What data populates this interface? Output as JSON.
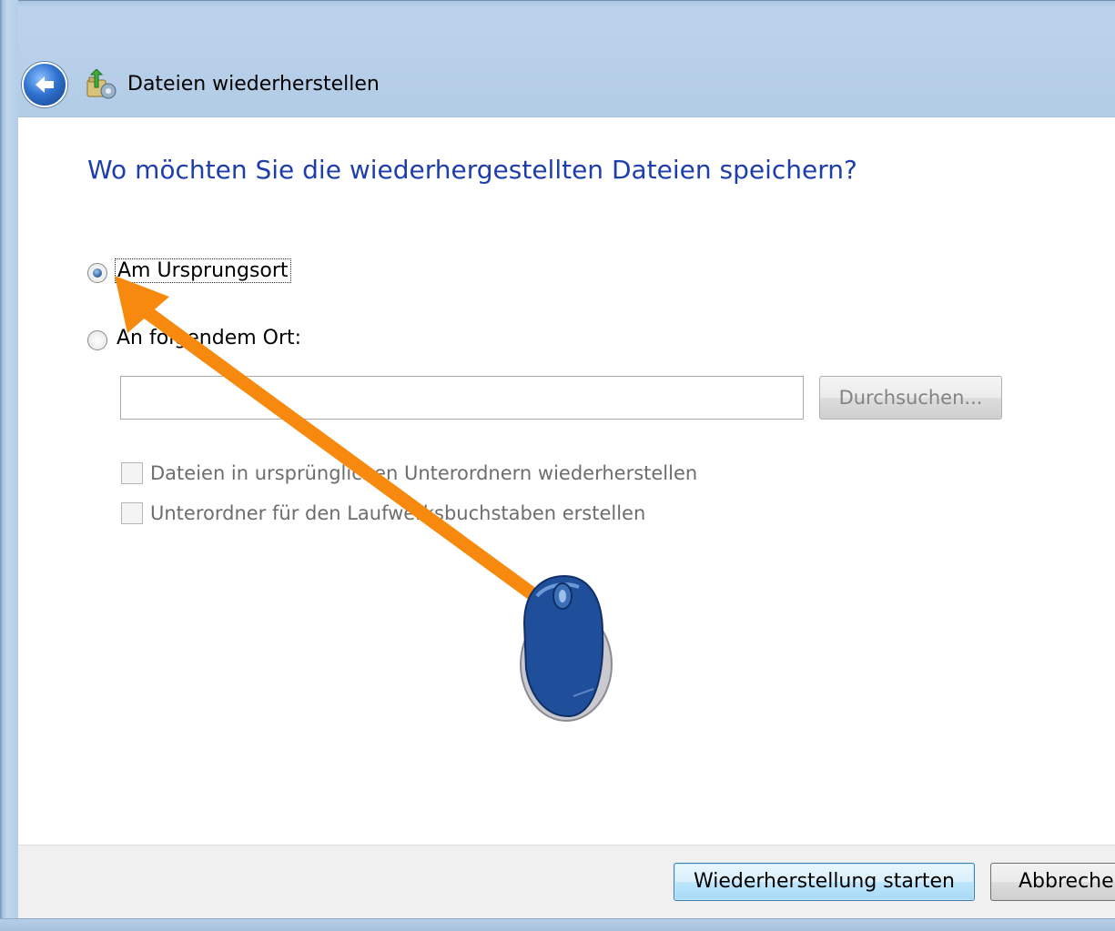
{
  "window": {
    "title": "Dateien wiederherstellen",
    "back_icon": "back-arrow-icon",
    "app_icon": "restore-files-icon"
  },
  "main": {
    "heading": "Wo möchten Sie die wiederhergestellten Dateien speichern?",
    "options": [
      {
        "label": "Am Ursprungsort",
        "selected": true
      },
      {
        "label": "An folgendem Ort:",
        "selected": false
      }
    ],
    "location_input": {
      "value": "",
      "placeholder": ""
    },
    "browse_label": "Durchsuchen...",
    "checkboxes": [
      {
        "label": "Dateien in ursprünglichen Unterordnern wiederherstellen",
        "checked": false,
        "enabled": false
      },
      {
        "label": "Unterordner für den Laufwerksbuchstaben erstellen",
        "checked": false,
        "enabled": false
      }
    ]
  },
  "footer": {
    "start_label": "Wiederherstellung starten",
    "cancel_label": "Abbrechen"
  },
  "overlay": {
    "arrow_color": "#f7890f",
    "mouse_color": "#1f4f9a"
  }
}
